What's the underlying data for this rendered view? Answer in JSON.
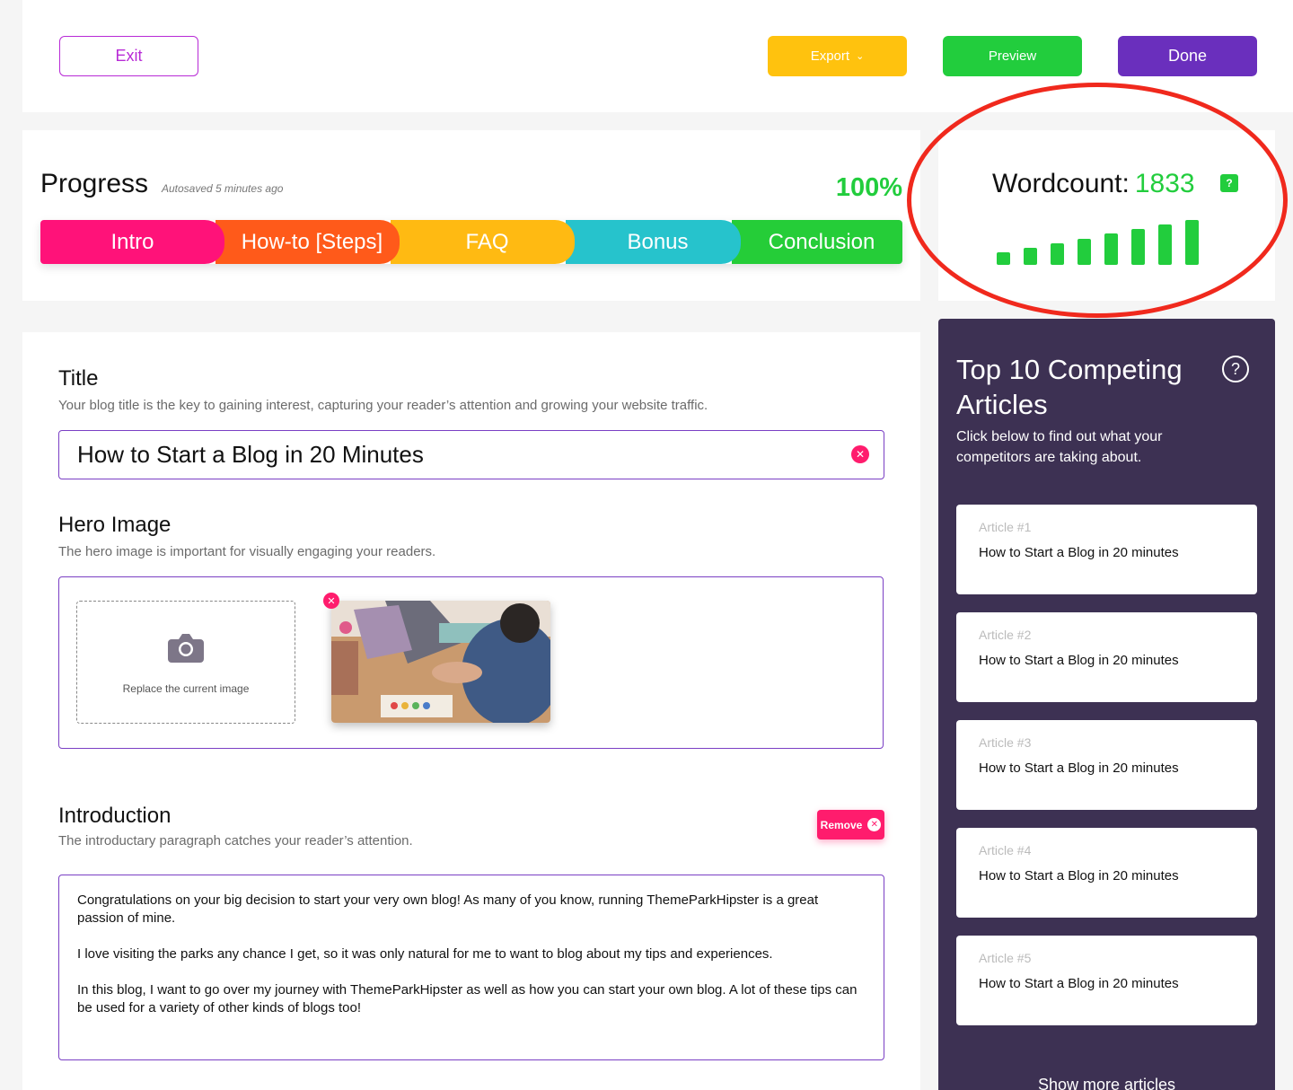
{
  "topbar": {
    "exit_label": "Exit",
    "export_label": "Export",
    "preview_label": "Preview",
    "done_label": "Done"
  },
  "progress": {
    "title": "Progress",
    "autosave": "Autosaved 5 minutes ago",
    "percent": "100%",
    "steps": [
      "Intro",
      "How-to [Steps]",
      "FAQ",
      "Bonus",
      "Conclusion"
    ]
  },
  "wordcount": {
    "label": "Wordcount:",
    "value": "1833",
    "help": "?",
    "bars_filled": 8,
    "bars_total": 8
  },
  "editor": {
    "title_heading": "Title",
    "title_desc": "Your blog title is the key to gaining interest, capturing your reader’s attention and growing your website traffic.",
    "title_value": "How to Start a Blog in 20 Minutes",
    "hero_heading": "Hero Image",
    "hero_desc": "The hero image is important for visually engaging your readers.",
    "hero_upload_label": "Replace the current image",
    "intro_heading": "Introduction",
    "intro_desc": "The introductary paragraph catches your reader’s attention.",
    "remove_label": "Remove",
    "intro_paragraphs": [
      "Congratulations on your big decision to start your very own blog! As many of you know, running ThemeParkHipster is a great passion of mine.",
      "I love visiting the parks any chance I get, so it was only natural for me to want to blog about my tips and experiences.",
      "In this blog, I want to go over my journey with ThemeParkHipster as well as how you can start your own blog. A lot of these tips can be used for a variety of other kinds of blogs too!"
    ]
  },
  "competitors": {
    "title": "Top 10 Competing Articles",
    "subtitle": "Click below to find out what your competitors are taking about.",
    "help": "?",
    "articles": [
      {
        "num": "Article #1",
        "title": "How to Start a Blog in 20 minutes"
      },
      {
        "num": "Article #2",
        "title": "How to Start a Blog in 20 minutes"
      },
      {
        "num": "Article #3",
        "title": "How to Start a Blog in 20 minutes"
      },
      {
        "num": "Article #4",
        "title": "How to Start a Blog in 20 minutes"
      },
      {
        "num": "Article #5",
        "title": "How to Start a Blog in 20 minutes"
      }
    ],
    "show_more": "Show more articles"
  },
  "colors": {
    "accent_purple": "#6a2fbd",
    "green": "#22cd3d",
    "pink": "#ff1c6d",
    "yellow": "#ffc20e",
    "annotation_red": "#f0291d"
  }
}
